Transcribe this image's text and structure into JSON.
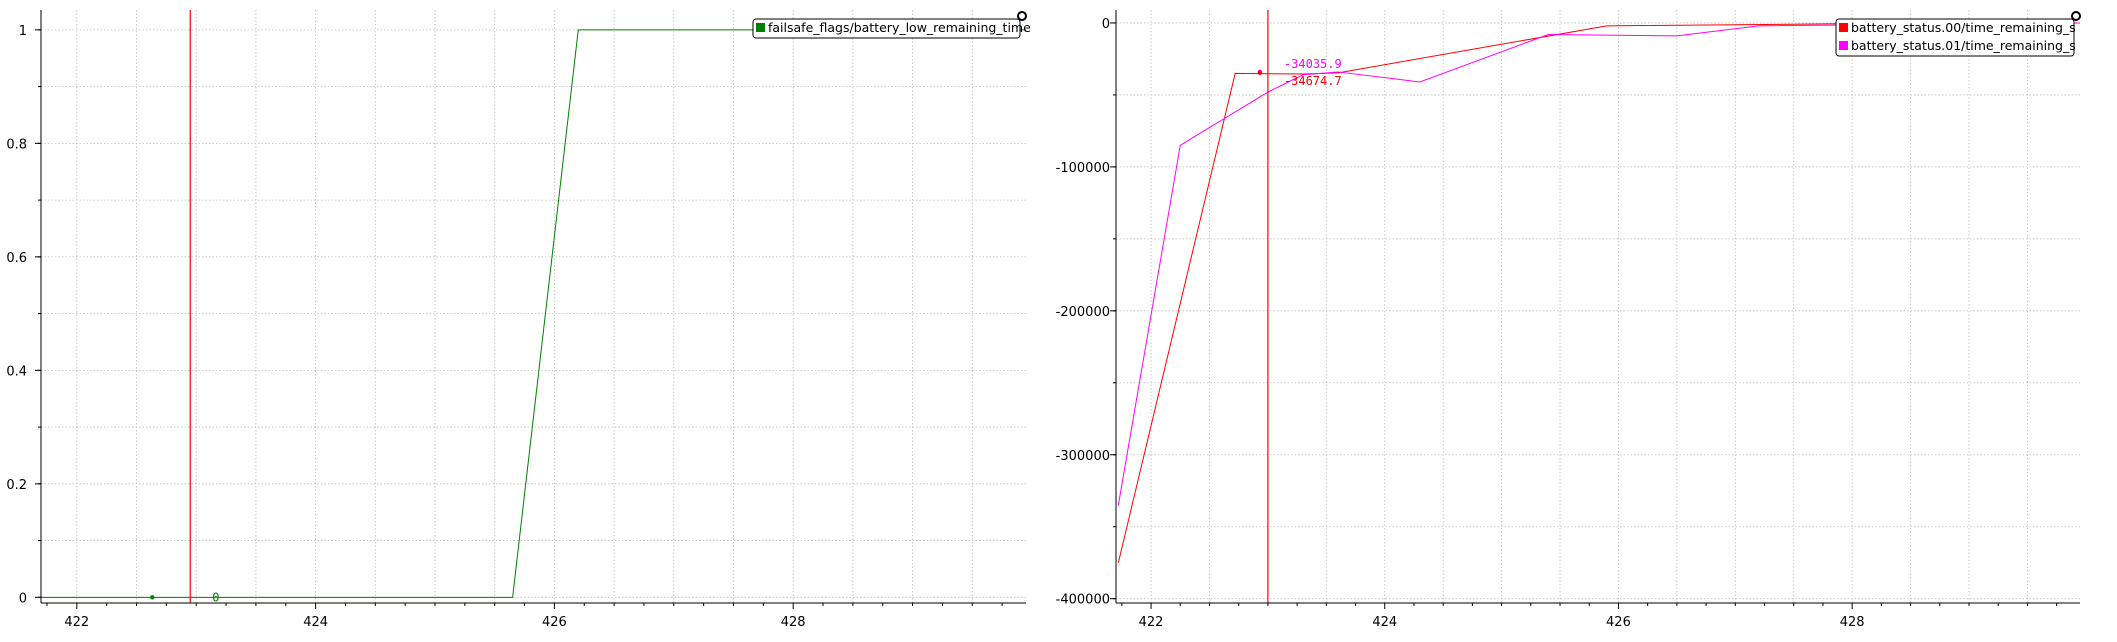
{
  "chart_data": [
    {
      "type": "line",
      "xlim": [
        421.7,
        429.95
      ],
      "ylim": [
        -0.01,
        1.035
      ],
      "x_ticks": [
        422,
        424,
        426,
        428
      ],
      "y_ticks": [
        0,
        0.2,
        0.4,
        0.6,
        0.8,
        1
      ],
      "y_tick_labels": [
        "0",
        "0.2",
        "0.4",
        "0.6",
        "0.8",
        "1"
      ],
      "grid": true,
      "legend_position": "top-right",
      "cursor_x": 422.95,
      "series": [
        {
          "name": "failsafe_flags/battery_low_remaining_time",
          "color": "#008000",
          "x": [
            421.7,
            425.65,
            426.2,
            429.95
          ],
          "y": [
            0,
            0,
            1,
            1
          ]
        }
      ],
      "annotations": [
        {
          "text": "0",
          "x": 422.9,
          "y": 0,
          "color": "#008000"
        }
      ]
    },
    {
      "type": "line",
      "xlim": [
        421.7,
        429.95
      ],
      "ylim": [
        -403000,
        9000
      ],
      "x_ticks": [
        422,
        424,
        426,
        428
      ],
      "y_ticks": [
        0,
        -100000,
        -200000,
        -300000,
        -400000
      ],
      "y_tick_labels": [
        "0",
        "-100000",
        "-200000",
        "-300000",
        "-400000"
      ],
      "grid": true,
      "legend_position": "top-right",
      "cursor_x": 423.0,
      "series": [
        {
          "name": "battery_status.00/time_remaining_s",
          "color": "#ff0000",
          "x": [
            421.72,
            422.72,
            423.3,
            423.6,
            425.9,
            428.0,
            429.95
          ],
          "y": [
            -375000,
            -35000,
            -35500,
            -34674.7,
            -2000,
            -500,
            0
          ]
        },
        {
          "name": "battery_status.01/time_remaining_s",
          "color": "#ff00ff",
          "x": [
            421.72,
            422.25,
            423.0,
            423.3,
            423.6,
            424.3,
            425.4,
            426.5,
            427.2,
            429.95
          ],
          "y": [
            -335000,
            -85000,
            -48000,
            -36000,
            -34035.9,
            -41000,
            -8000,
            -9000,
            -2000,
            0
          ]
        }
      ],
      "annotations": [
        {
          "text": "-34035.9",
          "x": 423.0,
          "y": -34035.9,
          "color": "#ff00ff"
        },
        {
          "text": "-34674.7",
          "x": 423.0,
          "y": -34674.7,
          "color": "#ff0000"
        }
      ]
    }
  ]
}
